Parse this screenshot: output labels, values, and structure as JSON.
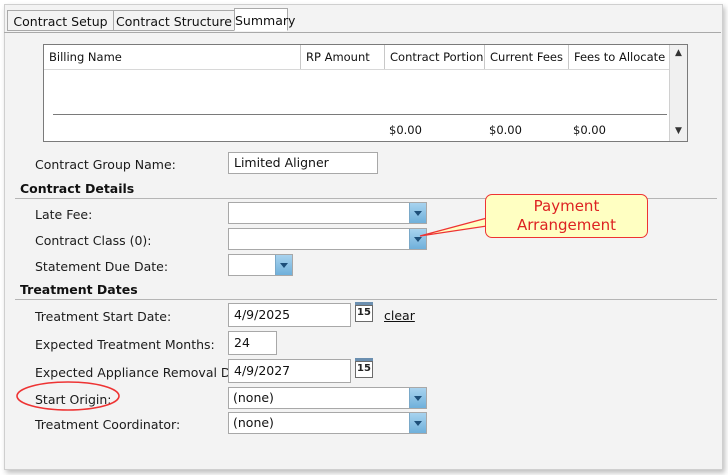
{
  "tabs": [
    {
      "label": "Contract Setup"
    },
    {
      "label": "Contract Structure"
    },
    {
      "label": "Summary"
    }
  ],
  "billing_grid": {
    "columns": [
      "Billing Name",
      "RP Amount",
      "Contract Portion",
      "Current Fees",
      "Fees to Allocate"
    ],
    "totals": {
      "contract_portion": "$0.00",
      "current_fees": "$0.00",
      "fees_to_allocate": "$0.00"
    },
    "scroll_up": "▲",
    "scroll_down": "▼"
  },
  "contract_group": {
    "label": "Contract Group Name:",
    "value": "Limited Aligner"
  },
  "contract_details": {
    "heading": "Contract Details",
    "late_fee": {
      "label": "Late Fee:",
      "value": ""
    },
    "contract_class": {
      "label": "Contract Class (0):",
      "value": ""
    },
    "statement_due_date": {
      "label": "Statement Due Date:",
      "value": ""
    }
  },
  "treatment_dates": {
    "heading": "Treatment Dates",
    "start_date": {
      "label": "Treatment Start Date:",
      "value": "4/9/2025",
      "calendar_day": "15",
      "clear": "clear"
    },
    "expected_months": {
      "label": "Expected Treatment Months:",
      "value": "24"
    },
    "removal_date": {
      "label": "Expected Appliance Removal Date:",
      "value": "4/9/2027",
      "calendar_day": "15"
    },
    "start_origin": {
      "label": "Start Origin:",
      "value": "(none)"
    },
    "coordinator": {
      "label": "Treatment Coordinator:",
      "value": "(none)"
    }
  },
  "annotation": {
    "text_line1": "Payment",
    "text_line2": "Arrangement",
    "color": "#dd2222"
  }
}
